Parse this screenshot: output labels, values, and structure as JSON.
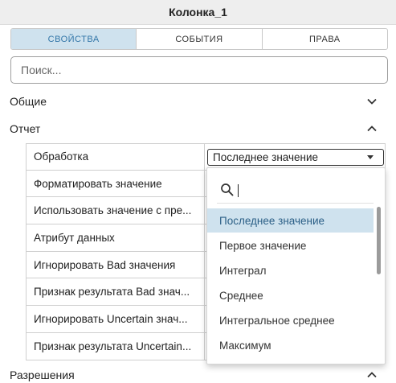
{
  "header": {
    "title": "Колонка_1"
  },
  "tabs": [
    {
      "label": "СВОЙСТВА",
      "active": true
    },
    {
      "label": "СОБЫТИЯ",
      "active": false
    },
    {
      "label": "ПРАВА",
      "active": false
    }
  ],
  "search": {
    "placeholder": "Поиск..."
  },
  "sections": {
    "general": {
      "label": "Общие",
      "expanded": false
    },
    "report": {
      "label": "Отчет",
      "expanded": true
    },
    "permissions": {
      "label": "Разрешения",
      "expanded": true
    }
  },
  "properties": [
    "Обработка",
    "Форматировать значение",
    "Использовать значение с пре...",
    "Атрибут данных",
    "Игнорировать Bad значения",
    "Признак результата Bad знач...",
    "Игнорировать Uncertain знач...",
    "Признак результата Uncertain..."
  ],
  "select": {
    "value": "Последнее значение"
  },
  "dropdown": {
    "options": [
      "Последнее значение",
      "Первое значение",
      "Интеграл",
      "Среднее",
      "Интегральное среднее",
      "Максимум"
    ],
    "selected_index": 0
  },
  "colors": {
    "accent_bg": "#cfe2ee",
    "accent_text": "#3276a8"
  }
}
